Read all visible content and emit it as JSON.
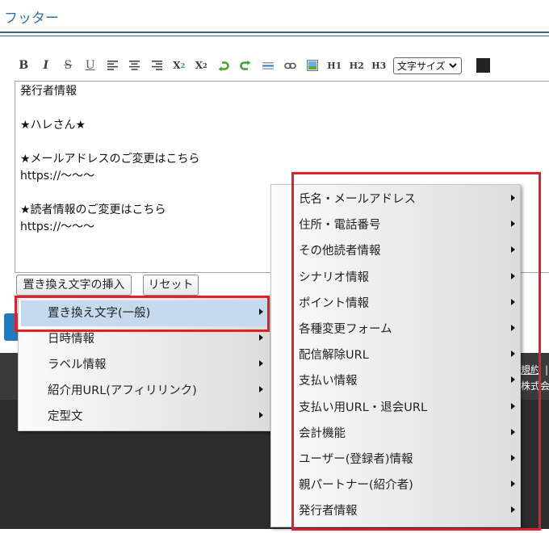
{
  "page": {
    "title": "フッター"
  },
  "toolbar": {
    "bold": "B",
    "italic": "I",
    "strikethrough": "S",
    "underline": "U",
    "subscript": {
      "base": "X",
      "index": "2"
    },
    "superscript": {
      "base": "X",
      "index": "2"
    },
    "h1": "H1",
    "h2": "H2",
    "h3": "H3",
    "font_size_select": {
      "selected": "文字サイズ"
    },
    "text_color": "#222222",
    "icons": [
      "align-left-icon",
      "align-center-icon",
      "align-right-icon",
      "undo-icon",
      "redo-icon",
      "horizontal-rule-icon",
      "link-icon",
      "image-icon",
      "chevron-down-icon"
    ]
  },
  "editor": {
    "lines": [
      "発行者情報",
      "",
      "★ハレさん★",
      "",
      "★メールアドレスのご変更はこちら",
      "https://〜〜〜",
      "",
      "★読者情報のご変更はこちら",
      "https://〜〜〜"
    ]
  },
  "actions": {
    "insert_label": "置き換え文字の挿入",
    "reset_label": "リセット"
  },
  "menu": {
    "items": [
      {
        "label": "置き換え文字(一般)",
        "highlighted": true
      },
      {
        "label": "日時情報"
      },
      {
        "label": "ラベル情報"
      },
      {
        "label": "紹介用URL(アフィリリンク)"
      },
      {
        "label": "定型文"
      }
    ]
  },
  "submenu": {
    "items": [
      "氏名・メールアドレス",
      "住所・電話番号",
      "その他読者情報",
      "シナリオ情報",
      "ポイント情報",
      "各種変更フォーム",
      "配信解除URL",
      "支払い情報",
      "支払い用URL・退会URL",
      "会計機能",
      "ユーザー(登録者)情報",
      "親パートナー(紹介者)",
      "発行者情報"
    ]
  },
  "footer": {
    "link": "規約",
    "separator": "|",
    "company": "株式会"
  },
  "colors": {
    "title": "#3370a6",
    "divider": "#3b6b80",
    "menu_highlight": "#c5daef",
    "annotation": "#e3202a",
    "footer": "#2c2c2c"
  }
}
